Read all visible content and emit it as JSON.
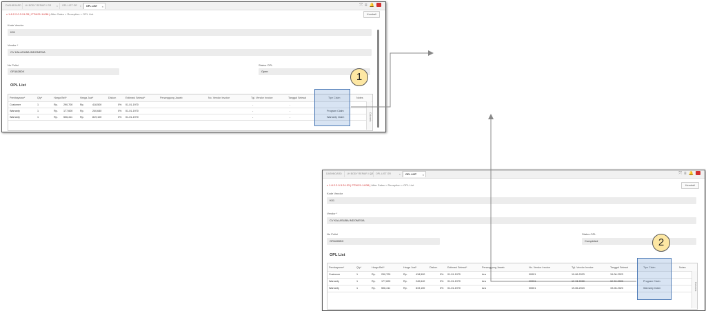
{
  "tabs": [
    "DASHBOARD",
    "LH BODY REPAIR / GR",
    "OPL LIST GR",
    "OPL LIST"
  ],
  "breadcrumb": {
    "version": "v 1.8.2.2.0.3.24.33 | PTHI21-14/36 |",
    "path": "After Sales > Reception > OPL List"
  },
  "back_label": "Kembali",
  "labels": {
    "kode_vendor": "Kode Vendor",
    "vendor": "Vendor *",
    "no_polisi": "No Polisi",
    "status_opl": "Status OPL",
    "opl_list": "OPL List",
    "columns": "Columns"
  },
  "values": {
    "kode_vendor": "K01",
    "vendor": "CV KALASUBA INDONESIA",
    "no_polisi": "GR1828DX"
  },
  "columns": [
    "Pembayaran*",
    "Qty*",
    "Harga Beli*",
    "Harga Jual*",
    "Diskon",
    "Estimasi Selesai*",
    "Penanggung Jawab",
    "No. Vendor Invoice",
    "Tgl. Vendor Invoice",
    "Tanggal Selesai",
    "Tipe Claim",
    "Notes"
  ],
  "before": {
    "status": "Open",
    "rows": [
      [
        "Customer",
        "1",
        "Rp.",
        "290,700",
        "Rp.",
        "418,500",
        "0%",
        "01-01-1970",
        "",
        "-",
        "-",
        "",
        ""
      ],
      [
        "Warranty",
        "1",
        "Rp.",
        "177,600",
        "Rp.",
        "240,640",
        "0%",
        "01-01-1970",
        "",
        "-",
        "-",
        "Program Claim",
        ""
      ],
      [
        "Warranty",
        "1",
        "Rp.",
        "506,411",
        "Rp.",
        "819,100",
        "0%",
        "01-01-1970",
        "",
        "-",
        "-",
        "Warranty Claim",
        ""
      ]
    ]
  },
  "after": {
    "status": "Completed",
    "rows": [
      [
        "Customer",
        "1",
        "Rp.",
        "290,700",
        "Rp.",
        "418,500",
        "0%",
        "01-01-1970",
        "Ara",
        "00001",
        "19-06-2023",
        "19-06-2023",
        "",
        ""
      ],
      [
        "Warranty",
        "1",
        "Rp.",
        "177,600",
        "Rp.",
        "240,640",
        "0%",
        "01-01-1970",
        "Ara",
        "00001",
        "19-06-2023",
        "19-06-2023",
        "Program Claim",
        ""
      ],
      [
        "Warranty",
        "1",
        "Rp.",
        "506,411",
        "Rp.",
        "819,100",
        "0%",
        "01-01-1970",
        "Ara",
        "00001",
        "19-06-2023",
        "19-06-2023",
        "Warranty Claim",
        ""
      ]
    ]
  },
  "callouts": [
    "1",
    "2"
  ],
  "colors": {
    "version": "#d32f2f",
    "highlight": "#4a78b5",
    "callout": "#fde7a3"
  }
}
